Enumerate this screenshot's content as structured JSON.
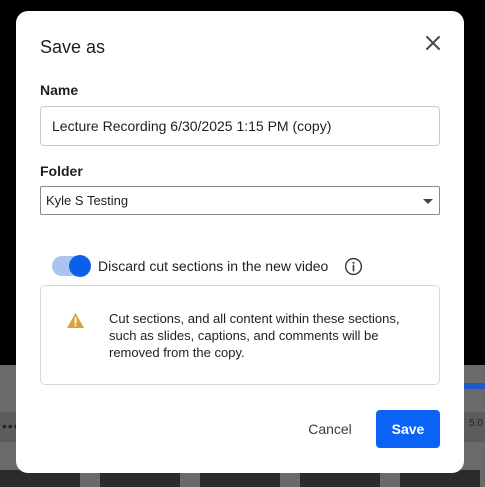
{
  "background": {
    "dots": "•••",
    "time": "5:0"
  },
  "dialog": {
    "title": "Save as",
    "name_label": "Name",
    "name_value": "Lecture Recording 6/30/2025 1:15 PM (copy)",
    "folder_label": "Folder",
    "folder_value": "Kyle S Testing",
    "discard_label": "Discard cut sections in the new video",
    "discard_enabled": true,
    "warning_text": "Cut sections, and all content within these sections, such as slides, captions, and comments will be removed from the copy.",
    "cancel_label": "Cancel",
    "save_label": "Save"
  },
  "colors": {
    "accent": "#0b63f6",
    "warning": "#d4a63a"
  },
  "icons": [
    "close-icon",
    "chevron-down-icon",
    "info-icon",
    "warning-icon"
  ]
}
